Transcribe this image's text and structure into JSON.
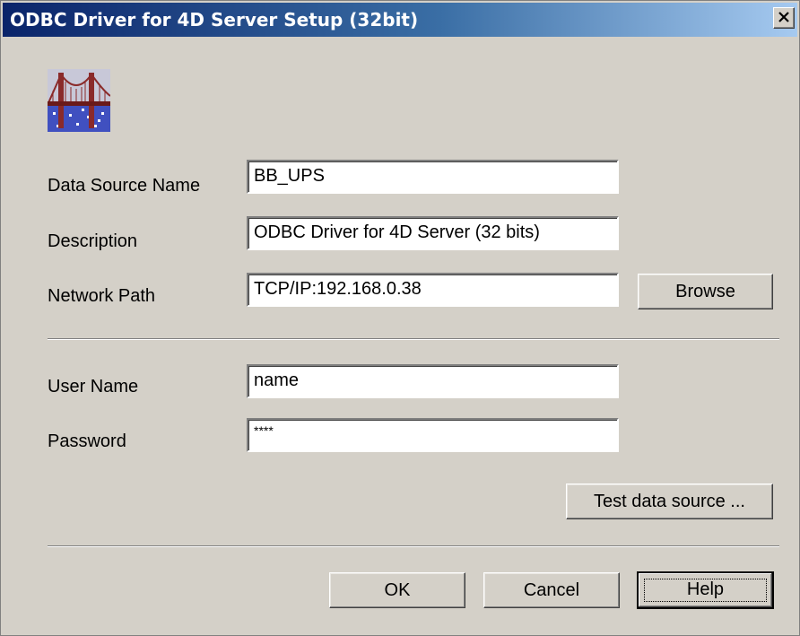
{
  "window": {
    "title": "ODBC Driver for 4D Server Setup (32bit)"
  },
  "form": {
    "dsn_label": "Data Source Name",
    "dsn_value": "BB_UPS",
    "description_label": "Description",
    "description_value": "ODBC Driver for 4D Server (32 bits)",
    "network_label": "Network Path",
    "network_value": "TCP/IP:192.168.0.38",
    "username_label": "User Name",
    "username_value": "name",
    "password_label": "Password",
    "password_value": "****"
  },
  "buttons": {
    "browse": "Browse",
    "test": "Test data source ...",
    "ok": "OK",
    "cancel": "Cancel",
    "help": "Help"
  },
  "colors": {
    "titlebar_start": "#0a246a",
    "titlebar_end": "#a6caf0",
    "dialog_bg": "#d4d0c8"
  },
  "icons": [
    "odbc-bridge-icon",
    "close-icon"
  ]
}
